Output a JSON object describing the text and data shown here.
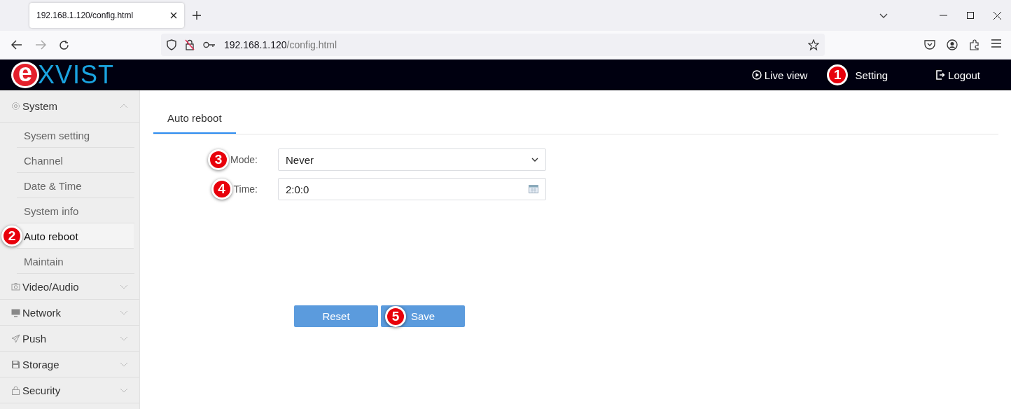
{
  "browser": {
    "tab_title": "192.168.1.120/config.html",
    "url_host": "192.168.1.120",
    "url_path": "/config.html"
  },
  "header": {
    "logo": {
      "mark": "e",
      "text": "XVIST"
    },
    "nav": [
      {
        "label": "Live view",
        "kind": "play"
      },
      {
        "label": "Setting",
        "kind": "plain",
        "badge": "1"
      },
      {
        "label": "Logout",
        "kind": "logout"
      }
    ]
  },
  "sidebar": {
    "groups": [
      {
        "label": "System",
        "kind": "gear",
        "expanded": true,
        "children": [
          {
            "label": "Sysem setting",
            "selected": false
          },
          {
            "label": "Channel",
            "selected": false
          },
          {
            "label": "Date & Time",
            "selected": false
          },
          {
            "label": "System info",
            "selected": false
          },
          {
            "label": "Auto reboot",
            "selected": true,
            "badge": "2"
          },
          {
            "label": "Maintain",
            "selected": false
          }
        ]
      },
      {
        "label": "Video/Audio",
        "kind": "camera",
        "expanded": false
      },
      {
        "label": "Network",
        "kind": "monitor",
        "expanded": false
      },
      {
        "label": "Push",
        "kind": "send",
        "expanded": false
      },
      {
        "label": "Storage",
        "kind": "disk",
        "expanded": false
      },
      {
        "label": "Security",
        "kind": "lock",
        "expanded": false
      }
    ]
  },
  "tabs": [
    {
      "label": "Auto reboot",
      "selected": true
    }
  ],
  "form": {
    "fields": [
      {
        "label": "Mode:",
        "kind": "select",
        "value": "Never",
        "badge": "3"
      },
      {
        "label": "Time:",
        "kind": "time",
        "value": "2:0:0",
        "badge": "4"
      }
    ]
  },
  "buttons": [
    {
      "label": "Reset"
    },
    {
      "label": "Save",
      "badge": "5"
    }
  ]
}
